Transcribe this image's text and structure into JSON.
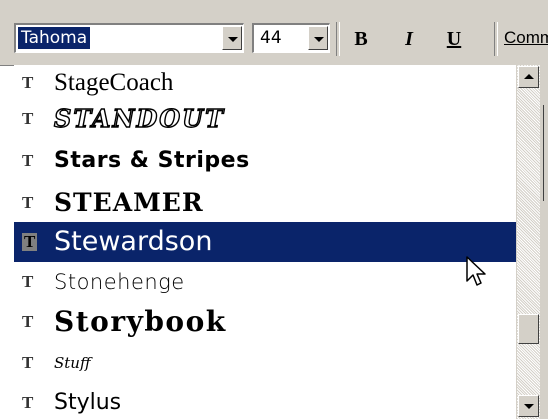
{
  "toolbar": {
    "font_name": "Tahoma",
    "font_size": "44",
    "bold_label": "B",
    "italic_label": "I",
    "underline_label": "U",
    "comments_label": "Comm"
  },
  "font_list": {
    "items": [
      {
        "label": "StageCoach",
        "icon": "truetype-font-icon",
        "selected": false
      },
      {
        "label": "STANDOUT",
        "icon": "truetype-font-icon",
        "selected": false
      },
      {
        "label": "Stars & Stripes",
        "icon": "truetype-font-icon",
        "selected": false
      },
      {
        "label": "STEAMER",
        "icon": "truetype-font-icon",
        "selected": false
      },
      {
        "label": "Stewardson",
        "icon": "truetype-font-icon",
        "selected": true
      },
      {
        "label": "Stonehenge",
        "icon": "truetype-font-icon",
        "selected": false
      },
      {
        "label": "Storybook",
        "icon": "truetype-font-icon",
        "selected": false
      },
      {
        "label": "Stuff",
        "icon": "truetype-font-icon",
        "selected": false
      },
      {
        "label": "Stylus",
        "icon": "truetype-font-icon",
        "selected": false
      }
    ],
    "icon_glyph": "T"
  },
  "colors": {
    "selection": "#0a246a",
    "face": "#d4d0c8"
  },
  "scroll_position": 0.62
}
